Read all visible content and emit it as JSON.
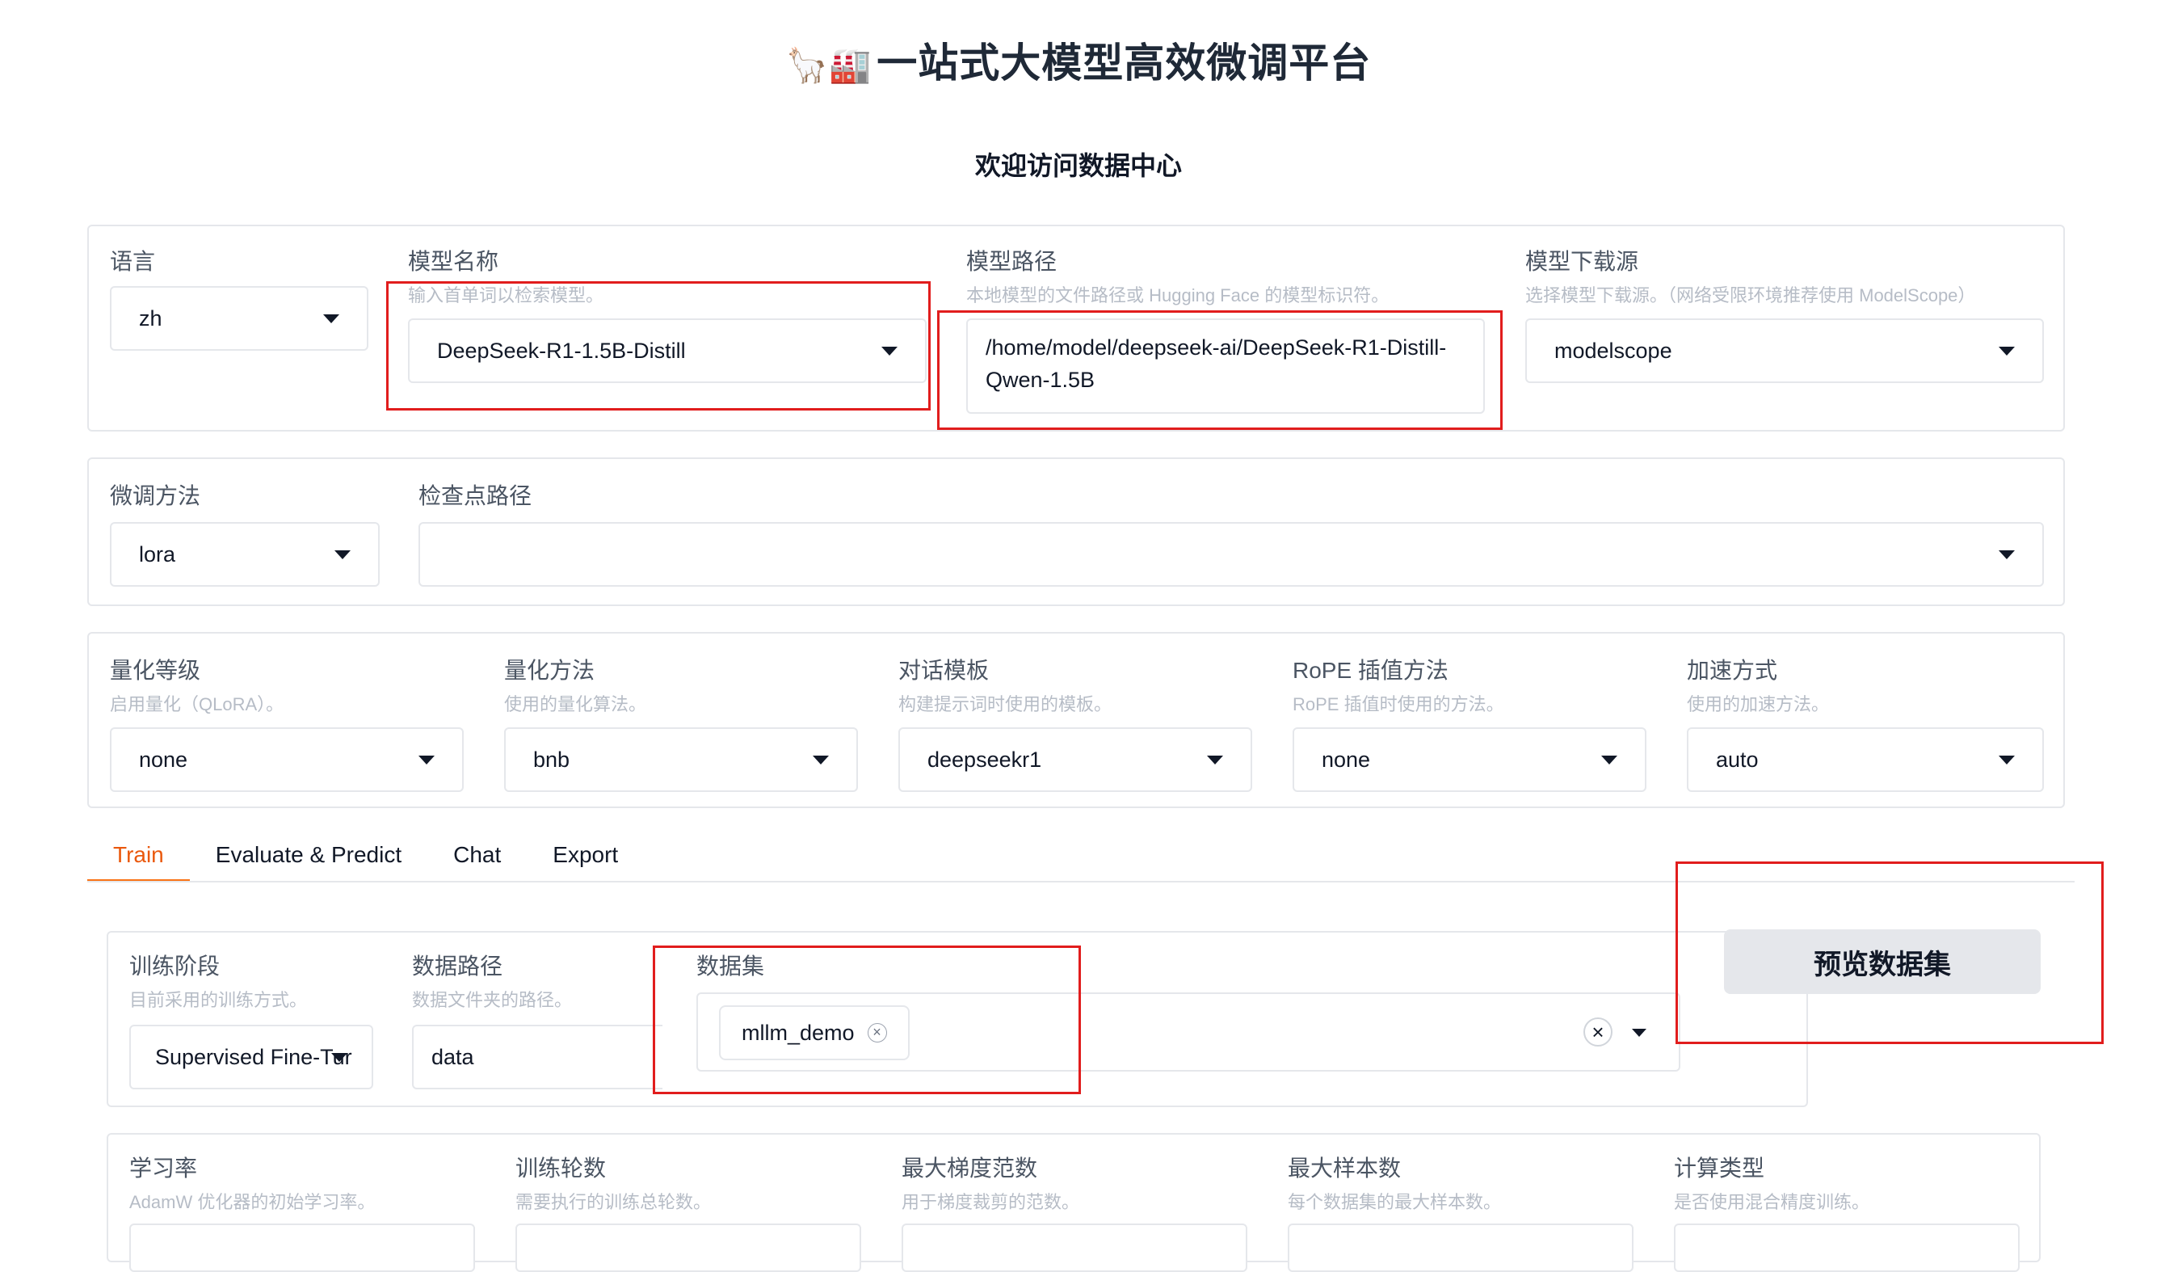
{
  "header": {
    "emoji": "🦙🏭",
    "title": "一站式大模型高效微调平台",
    "subtitle": "欢迎访问数据中心"
  },
  "row1": {
    "language": {
      "label": "语言",
      "value": "zh"
    },
    "model_name": {
      "label": "模型名称",
      "info": "输入首单词以检索模型。",
      "value": "DeepSeek-R1-1.5B-Distill"
    },
    "model_path": {
      "label": "模型路径",
      "info": "本地模型的文件路径或 Hugging Face 的模型标识符。",
      "value": "/home/model/deepseek-ai/DeepSeek-R1-Distill-Qwen-1.5B"
    },
    "model_source": {
      "label": "模型下载源",
      "info": "选择模型下载源。（网络受限环境推荐使用 ModelScope）",
      "value": "modelscope"
    }
  },
  "row2": {
    "finetune_method": {
      "label": "微调方法",
      "value": "lora"
    },
    "checkpoint_path": {
      "label": "检查点路径",
      "value": ""
    }
  },
  "row3": {
    "quant_level": {
      "label": "量化等级",
      "info": "启用量化（QLoRA）。",
      "value": "none"
    },
    "quant_method": {
      "label": "量化方法",
      "info": "使用的量化算法。",
      "value": "bnb"
    },
    "template": {
      "label": "对话模板",
      "info": "构建提示词时使用的模板。",
      "value": "deepseekr1"
    },
    "rope": {
      "label": "RoPE 插值方法",
      "info": "RoPE 插值时使用的方法。",
      "value": "none"
    },
    "booster": {
      "label": "加速方式",
      "info": "使用的加速方法。",
      "value": "auto"
    }
  },
  "tabs": [
    "Train",
    "Evaluate & Predict",
    "Chat",
    "Export"
  ],
  "train": {
    "stage": {
      "label": "训练阶段",
      "info": "目前采用的训练方式。",
      "value": "Supervised Fine-Tur"
    },
    "dataset_dir": {
      "label": "数据路径",
      "info": "数据文件夹的路径。",
      "value": "data"
    },
    "dataset": {
      "label": "数据集",
      "chip": "mllm_demo",
      "chip_close": "×",
      "clear": "×"
    },
    "preview_button": "预览数据集"
  },
  "row5": {
    "learning_rate": {
      "label": "学习率",
      "info": "AdamW 优化器的初始学习率。"
    },
    "epochs": {
      "label": "训练轮数",
      "info": "需要执行的训练总轮数。"
    },
    "max_grad_norm": {
      "label": "最大梯度范数",
      "info": "用于梯度裁剪的范数。"
    },
    "max_samples": {
      "label": "最大样本数",
      "info": "每个数据集的最大样本数。"
    },
    "compute_type": {
      "label": "计算类型",
      "info": "是否使用混合精度训练。"
    }
  },
  "colors": {
    "accent": "#f97316",
    "annotation_red": "#e11d1d"
  }
}
